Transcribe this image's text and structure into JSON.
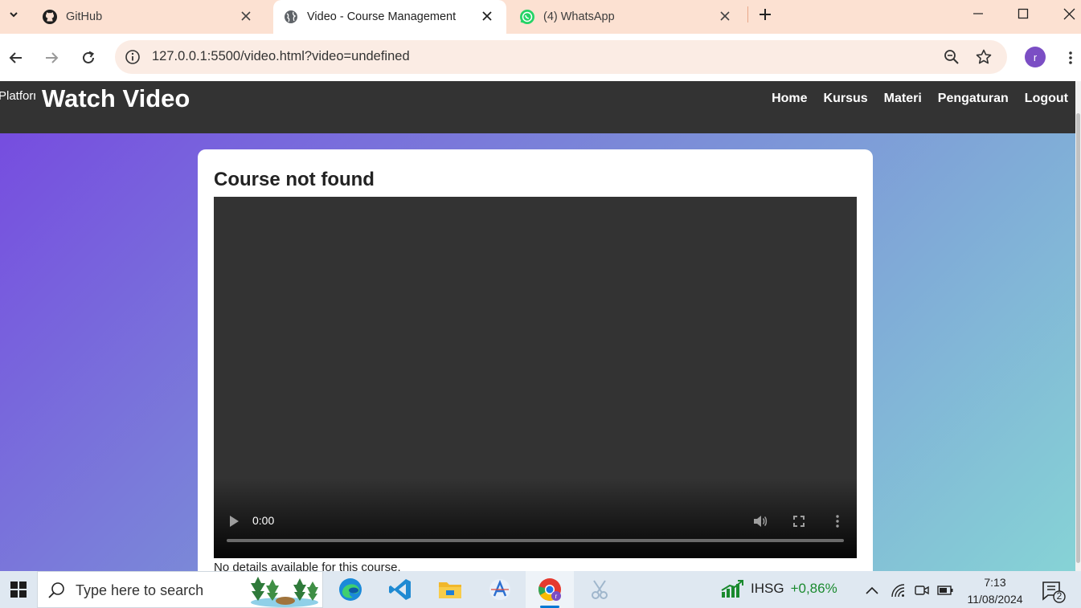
{
  "browser": {
    "tabs": [
      {
        "title": "GitHub",
        "icon": "github-icon",
        "active": false
      },
      {
        "title": "Video - Course Management",
        "icon": "globe-icon",
        "active": true
      },
      {
        "title": "(4) WhatsApp",
        "icon": "whatsapp-icon",
        "active": false
      }
    ],
    "url": "127.0.0.1:5500/video.html?video=undefined",
    "profile_initial": "r"
  },
  "site": {
    "logo_alt": "Platform Logo",
    "title": "Watch Video",
    "nav": [
      "Home",
      "Kursus",
      "Materi",
      "Pengaturan",
      "Logout"
    ]
  },
  "course": {
    "heading": "Course not found",
    "video_time": "0:00",
    "description": "No details available for this course."
  },
  "taskbar": {
    "search_placeholder": "Type here to search",
    "stock_name": "IHSG",
    "stock_change": "+0,86%",
    "time": "7:13",
    "date": "11/08/2024",
    "notification_count": "2"
  },
  "colors": {
    "tabstrip": "#fce1d2",
    "header_bg": "#333333",
    "gradient_start": "#7648e0",
    "gradient_end": "#86d3d6",
    "stock_up": "#1a8a2e",
    "avatar": "#7b4ec4"
  }
}
